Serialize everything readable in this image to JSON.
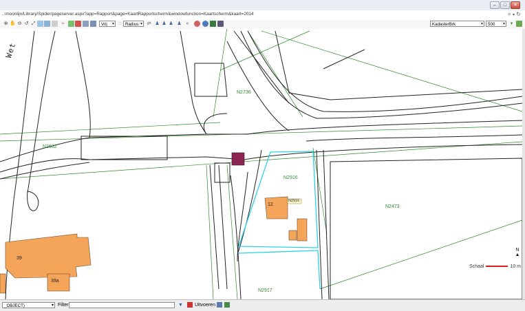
{
  "window": {
    "minimize": "–",
    "maximize": "□",
    "close": "✕"
  },
  "address": {
    "url": "..\\moonlijn/Library/Spider/pageserver.aspx?app=Rapport&page=KaartRapportscherm&windowfunction=Kaartscherm&kaart=2014",
    "search_icon": "⌕",
    "refresh_icon": "↻"
  },
  "toolbar": {
    "mode_select": "Vrij",
    "radius_select": "Radius:",
    "layer_select": "KadasterBrk",
    "scale_select": "500",
    "back_symbol": "«"
  },
  "map": {
    "street_name": "Wet",
    "parcels": {
      "n2736": "N2736",
      "n2662": "N2662",
      "n2916": "N2916",
      "n2473": "N2473",
      "n2917": "N2917"
    },
    "house_numbers": {
      "h12": "12",
      "h39": "39",
      "h39a": "39a"
    },
    "parcel_tag": "N2916",
    "north_letter": "N",
    "scale_label": "Schaal",
    "scale_value": "10 m",
    "colors": {
      "building": "#f5a55a",
      "selected": "#8e2454",
      "cyan_outline": "#2ad2e4",
      "parcel_line": "#2c8a2c"
    }
  },
  "bottom": {
    "object_select": "_OBJECT)",
    "filter_label": "Filter",
    "execute_label": "Uitvoeren"
  }
}
